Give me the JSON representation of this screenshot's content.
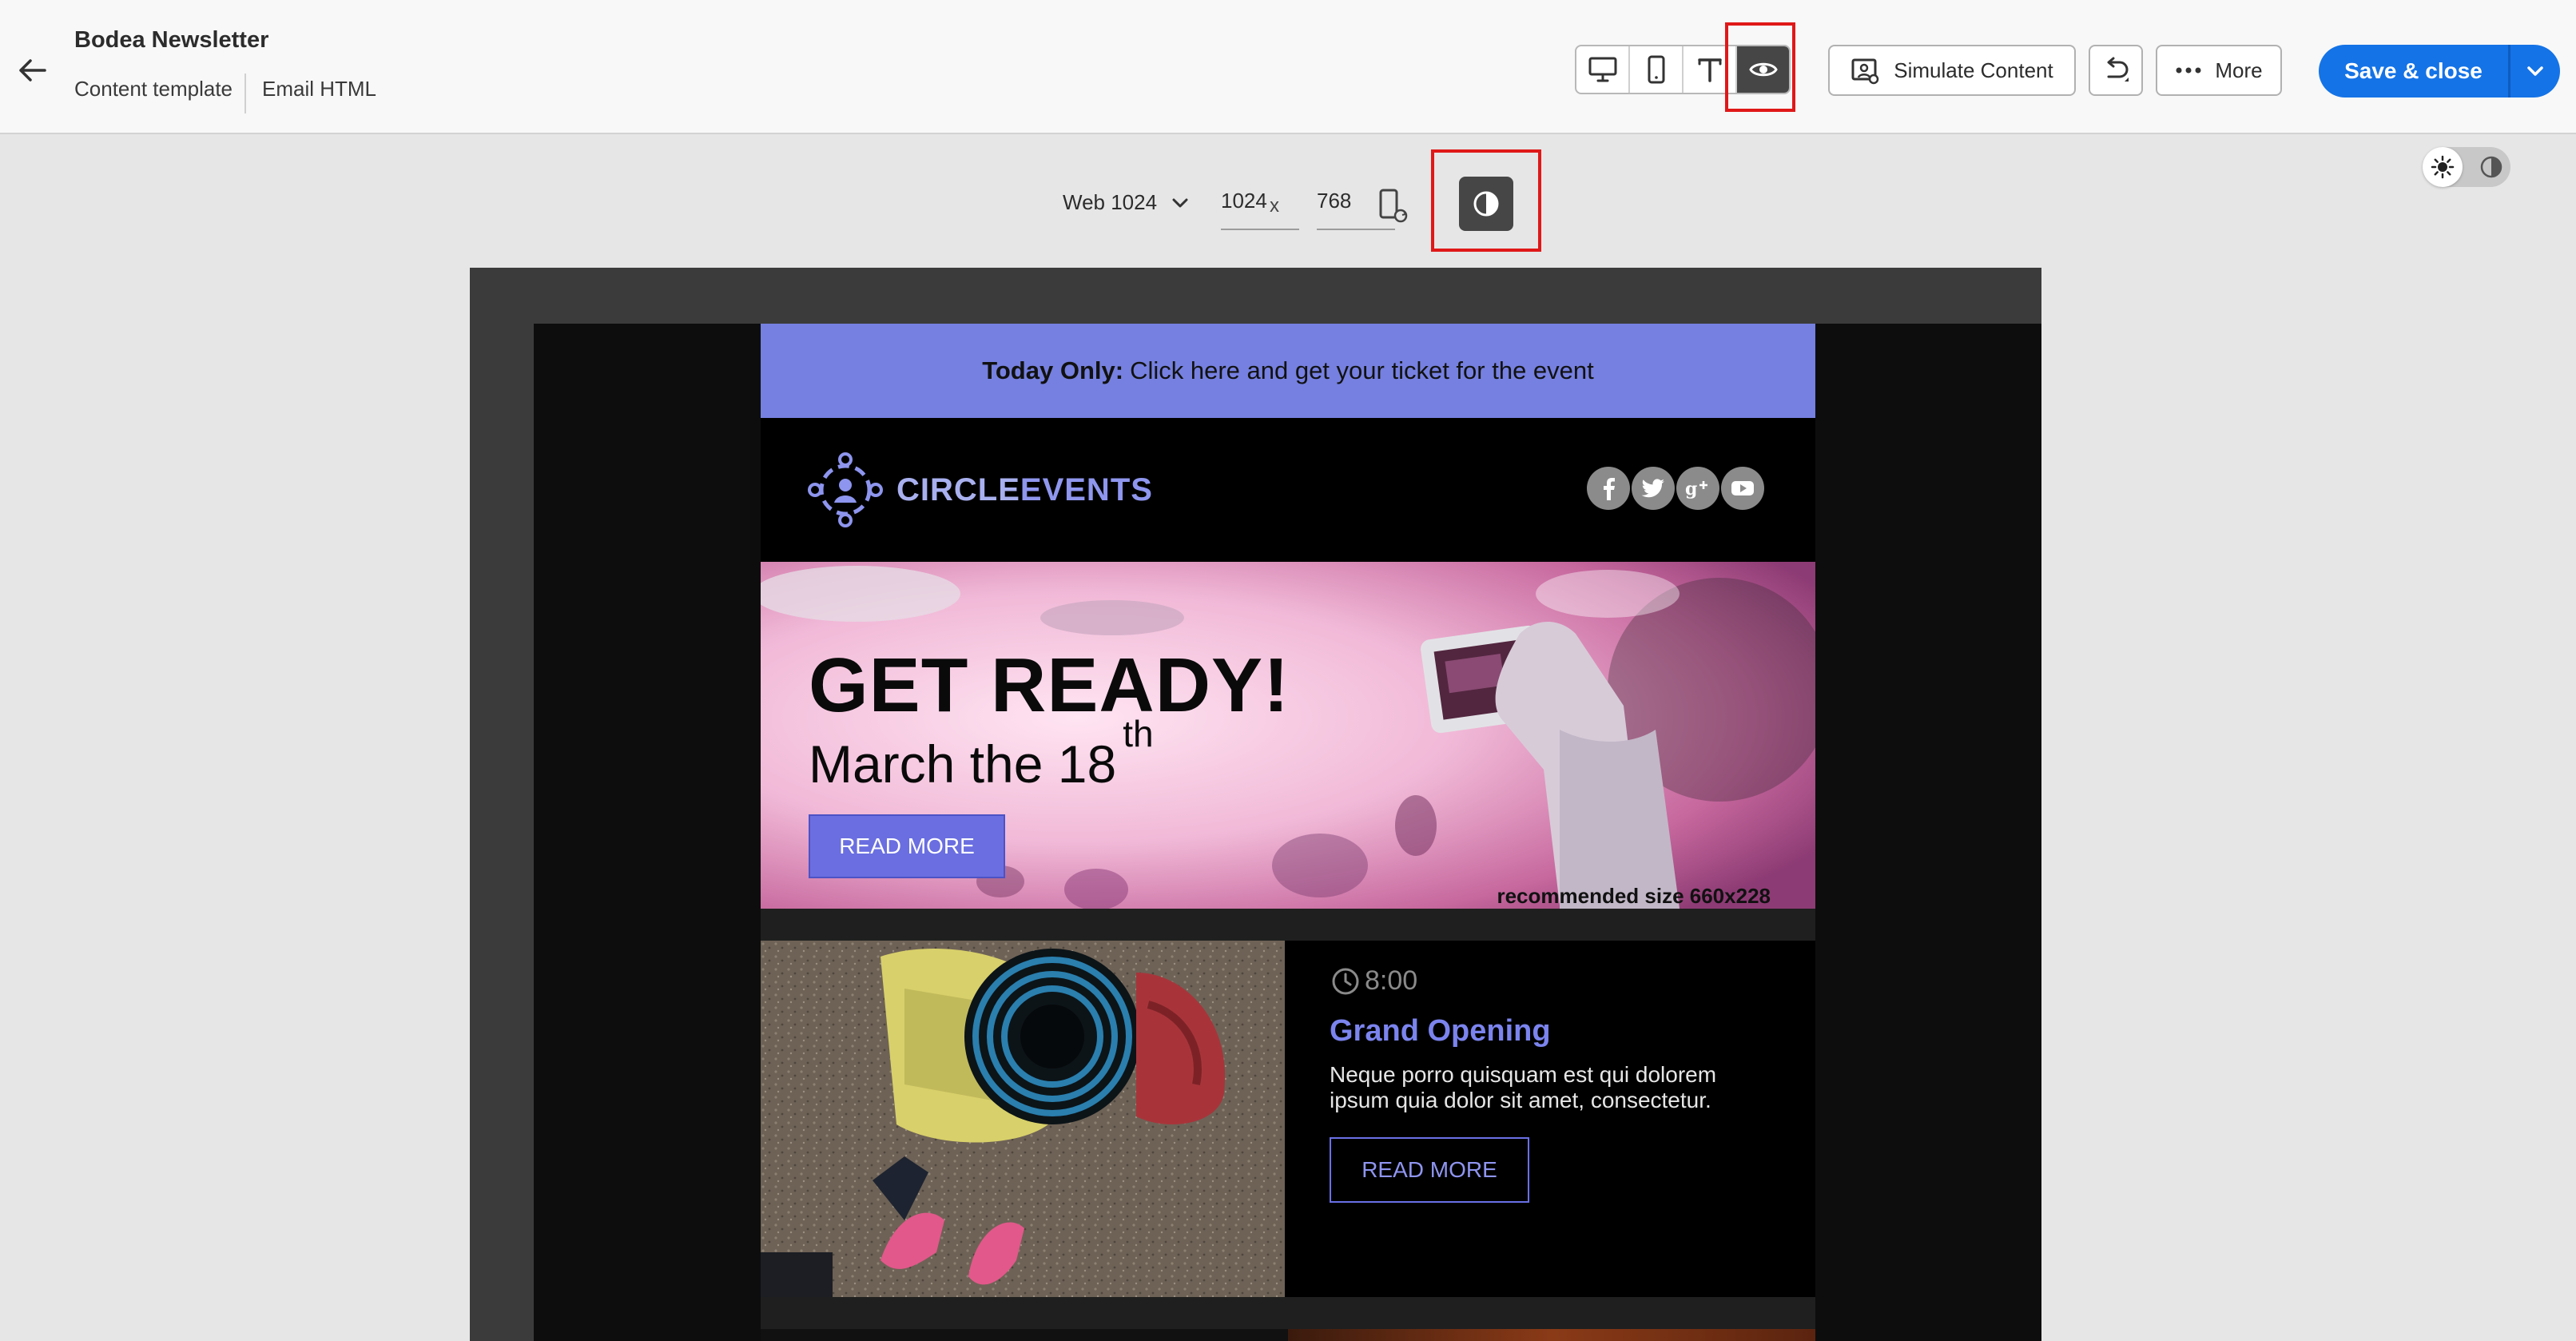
{
  "header": {
    "title": "Bodea Newsletter",
    "crumbs": [
      "Content template",
      "Email HTML"
    ],
    "simulate_label": "Simulate Content",
    "more_label": "More",
    "save_label": "Save & close"
  },
  "preview_toolbar": {
    "device": "Web 1024",
    "width": "1024",
    "x": "x",
    "height": "768"
  },
  "email": {
    "topbar_bold": "Today Only:",
    "topbar_text": "Click here and get your ticket for the event",
    "logo_part1": "CIRCLE",
    "logo_part2": "EVENTS",
    "social": [
      "f",
      "t",
      "g+",
      "yt"
    ],
    "hero_title": "GET READY!",
    "hero_date": "March the 18",
    "hero_date_sup": "th",
    "hero_button": "READ MORE",
    "hero_note": "recommended size 660x228",
    "card_time": "8:00",
    "card_title": "Grand Opening",
    "card_text": "Neque porro quisquam est qui dolorem ipsum quia dolor sit amet, consectetur.",
    "card_button": "READ MORE"
  },
  "colors": {
    "accent": "#1473e6",
    "topbar": "#7580e0",
    "highlight": "#e01818",
    "card_title": "#7b84ee"
  },
  "icons": [
    "back-arrow-icon",
    "desktop-icon",
    "mobile-icon",
    "text-icon",
    "eye-icon",
    "simulate-icon",
    "undo-icon",
    "more-icon",
    "chevron-down-icon",
    "rotate-icon",
    "contrast-icon",
    "sun-icon",
    "clock-icon"
  ]
}
